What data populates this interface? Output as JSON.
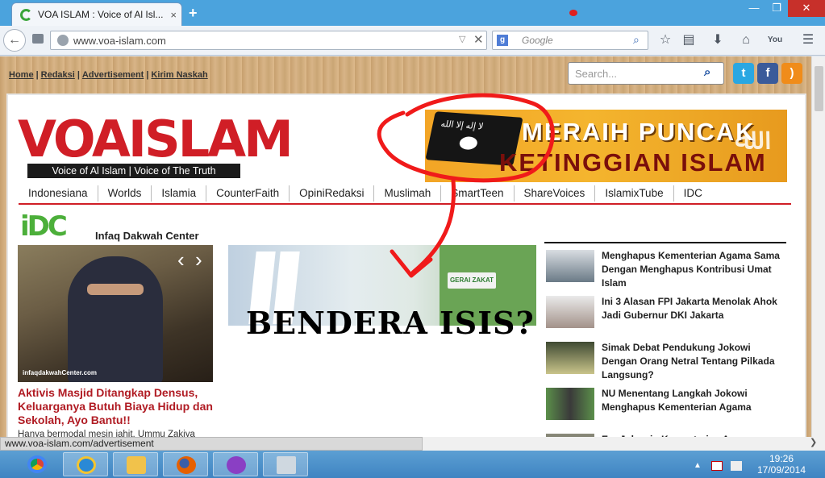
{
  "browser": {
    "tab_title": "VOA ISLAM : Voice of Al Isl...",
    "tab_close": "×",
    "new_tab": "+",
    "url": "www.voa-islam.com",
    "search_engine_placeholder": "Google",
    "window_controls": {
      "minimize": "—",
      "maximize": "❐",
      "close": "✕"
    }
  },
  "site": {
    "top_links": [
      "Home",
      "Redaksi",
      "Advertisement",
      "Kirim Naskah"
    ],
    "search_placeholder": "Search...",
    "social": {
      "twitter": "t",
      "facebook": "f",
      "rss": ")"
    },
    "logo": {
      "wordmark": "VOAISLAM",
      "tagline": "Voice of Al Islam  |  Voice of The Truth"
    },
    "banner": {
      "line1": "MERAIH PUNCAK",
      "line2": "KETINGGIAN ISLAM",
      "flag_text": "لا إله إلا الله"
    },
    "menu": [
      "Indonesiana",
      "Worlds",
      "Islamia",
      "CounterFaith",
      "OpiniRedaksi",
      "Muslimah",
      "SmartTeen",
      "ShareVoices",
      "IslamixTube",
      "IDC"
    ],
    "idc": {
      "mark": "iDC",
      "title": "Infaq Dakwah Center"
    },
    "featured": {
      "photo_caption": "infaqdakwahCenter.com",
      "headline": "Aktivis Masjid Ditangkap Densus, Keluarganya Butuh Biaya Hidup dan Sekolah, Ayo Bantu!!",
      "snippet": "Hanya bermodal mesin jahit, Ummu Zakiya"
    },
    "center_photo": {
      "sign": "GERAI ZAKAT"
    },
    "annotation_text": "BENDERA ISIS?",
    "news": [
      {
        "title": "Menghapus Kementerian Agama Sama Dengan Menghapus Kontribusi Umat Islam"
      },
      {
        "title": "Ini 3 Alasan FPI Jakarta Menolak Ahok Jadi Gubernur DKI Jakarta"
      },
      {
        "title": "Simak Debat Pendukung Jokowi Dengan Orang Netral Tentang Pilkada Langsung?"
      },
      {
        "title": "NU Menentang Langkah Jokowi Menghapus Kementerian Agama"
      },
      {
        "title": "Era Jokowi : Kementerian Agama"
      }
    ]
  },
  "status": {
    "link": "www.voa-islam.com/advertisement"
  },
  "taskbar": {
    "apps": [
      "chrome",
      "internet-explorer",
      "file-explorer",
      "firefox",
      "messenger",
      "calculator"
    ],
    "clock_time": "19:26",
    "clock_date": "17/09/2014"
  },
  "colors": {
    "accent_red": "#d01e26",
    "titlebar_blue": "#4ba3dd",
    "banner_orange": "#f3a526"
  }
}
